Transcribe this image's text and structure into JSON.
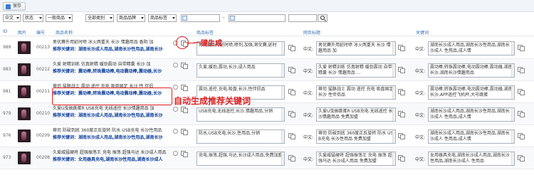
{
  "toolbar": {
    "save_label": "保存"
  },
  "filters": {
    "language": "中文",
    "status": "状态",
    "product_type": "一般商品",
    "category": "全部类别",
    "brand": "商品品牌",
    "tag": "商品标签",
    "date_separator": "-"
  },
  "columns": [
    "ID",
    "图片",
    "编号",
    "商品名称",
    "商品标签",
    "网页标题",
    "关键词"
  ],
  "annotations": {
    "one_click": "一键生成",
    "auto_keywords": "自动生成推荐关键词"
  },
  "rows": [
    {
      "id": "989",
      "code": "00213",
      "name": "男优賽外用延时喷 冰火两重天 长沙 情趣用品 香阴 加",
      "keyword_line": "推荐关键词：湖南长沙成人用品,湖南长沙性用品,湖南长沙",
      "tags": "男优賽外用延时喷,喷剂,加强,男优賽,延时",
      "lang1": "中文:",
      "title": "男优賽外用延时喷 冰火两重天 长沙 情趣用品 加",
      "lang2": "中文:",
      "keywords": "湖南长沙成人用品,湖南长沙性用品,湖南长沙成人 性用品,成人情"
    },
    {
      "id": "983",
      "code": "00212",
      "name": "久爱 射精训练 仿真射精 缓劲震动 自带精囊 长沙 加",
      "keyword_line": "推荐关键词：震动棒,转珠震动棒,电动震动棒,震动器,长沙",
      "tags": "久爱,缓劲,震动,长沙,成人用品",
      "lang1": "中文:",
      "title": "久爱 射精训练 仿真射精 缓劲震动 自带精囊 长沙 情趣用品 ...",
      "lang2": "中文:",
      "keywords": "震动棒,转珠震动棒,电动震动棒,震动器,湖南长沙,湖南长沙情趣用品"
    },
    {
      "id": "981",
      "code": "00211",
      "name": "蒂司 猛豚战士 震动 遥控 充电 吸盘固定 长沙 性 伴侣",
      "keyword_line": "推荐关键词：震动棒,转珠震动棒,电动震动棒,震动器,长沙",
      "tags": "震动,遥控,充电,吸盘,长沙,性伴侣品",
      "lang1": "中文:",
      "title": "蒂司 猛豚战士 震动 遥控 充电 吸盘固定 长沙 性伴侣品",
      "lang2": "中文:",
      "keywords": "震动棒,转珠震动棒,电动震动棒,震动器,湖南长沙,APP遥控飞机杯,大号跳蛋"
    },
    {
      "id": "979",
      "code": "00210",
      "name": "久爱U虫振跳蛋R USB充电 无线遥控 长沙情趣用品 加",
      "keyword_line": "推荐关键词：湖南长沙成人用品,湖南长沙性用品,湖南长沙",
      "tags": "USB充电,无线遥控,长沙,情趣用品,分销",
      "lang1": "中文:",
      "title": "久爱U虫振跳蛋R USB充电 无线遥控 长沙情趣用品 免费加盟",
      "lang2": "中文:",
      "keywords": "湖南长沙成人用品,湖南长沙性用品,湖南长沙成人 性用品,成人情"
    },
    {
      "id": "976",
      "code": "00209",
      "name": "蒂司 防破到底 360度正反旋转 防水 USB充电 长沙性用品",
      "keyword_line": "推荐关键词：湖南长沙成人用品,湖南长沙性用品,湖南长沙",
      "tags": "防水,USB充电,长沙,性用品,分销",
      "lang1": "中文:",
      "title": "蒂司 防破到底 360度正反旋转 防水 USB充电 长沙性用品 免费加盟",
      "lang2": "中文:",
      "keywords": "湖南长沙成人用品,湖南长沙性用品,湖南长沙成人 性用品,成人情"
    },
    {
      "id": "973",
      "code": "00208",
      "name": "久爱威猛硬将 超强振荡王 充电 振荡 超强马达 长沙成人用品",
      "keyword_line": "推荐关键词：女用器具充电,湖南长沙性用品,湖南长沙成人",
      "tags": "充电,振荡,超强,马达,长沙成人用品,免费加盟",
      "lang1": "中文:",
      "title": "久爱威猛硬将 超强振荡王 充电 振荡 超强马达 长沙成人用品 免费加盟",
      "lang2": "中文:",
      "keywords": "女用器具充电,湖南长沙成人用品,湖南长沙性用品,湖南长沙成人 性用品"
    }
  ]
}
